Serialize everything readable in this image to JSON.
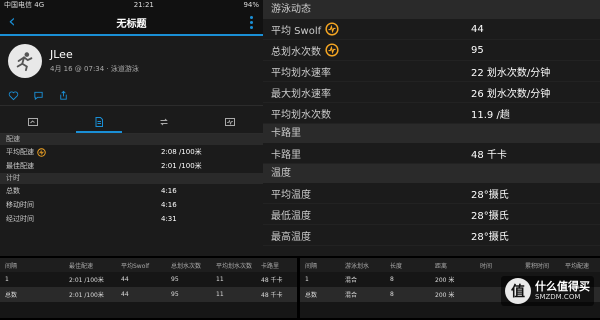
{
  "status": {
    "carrier": "中国电信",
    "network": "4G",
    "time": "21:21",
    "battery": "94%"
  },
  "nav": {
    "title": "无标题"
  },
  "profile": {
    "name": "JLee",
    "meta": "4月 16 @ 07:34 · 泳道游泳"
  },
  "left": {
    "pace_header": "配速",
    "avg_pace_label": "平均配速",
    "avg_pace_value": "2:08 /100米",
    "best_pace_label": "最佳配速",
    "best_pace_value": "2:01 /100米",
    "timing_header": "计时",
    "total_label": "总数",
    "total_value": "4:16",
    "moving_label": "移动时间",
    "moving_value": "4:16",
    "elapsed_label": "经过时间",
    "elapsed_value": "4:31"
  },
  "right": {
    "swim_header": "游泳动态",
    "swolf_label": "平均 Swolf",
    "swolf_value": "44",
    "strokes_label": "总划水次数",
    "strokes_value": "95",
    "avg_rate_label": "平均划水速率",
    "avg_rate_value": "22 划水次数/分钟",
    "max_rate_label": "最大划水速率",
    "max_rate_value": "26 划水次数/分钟",
    "avg_strokes_label": "平均划水次数",
    "avg_strokes_value": "11.9 /趟",
    "cal_header": "卡路里",
    "cal_label": "卡路里",
    "cal_value": "48 千卡",
    "temp_header": "温度",
    "avg_temp_label": "平均温度",
    "avg_temp_value": "28°摄氏",
    "min_temp_label": "最低温度",
    "min_temp_value": "28°摄氏",
    "max_temp_label": "最高温度",
    "max_temp_value": "28°摄氏"
  },
  "table1": {
    "headers": [
      "间隔",
      "最佳配速",
      "平均Swolf",
      "总划水次数",
      "平均划水次数",
      "卡路里"
    ],
    "rows": [
      [
        "1",
        "2:01 /100米",
        "44",
        "95",
        "11",
        "48 千卡"
      ],
      [
        "总数",
        "2:01 /100米",
        "44",
        "95",
        "11",
        "48 千卡"
      ]
    ]
  },
  "table2": {
    "headers": [
      "间隔",
      "游泳划水",
      "长度",
      "距离",
      "时间",
      "累积时间",
      "平均配速"
    ],
    "rows": [
      [
        "1",
        "混合",
        "8",
        "200 米",
        "",
        "",
        ""
      ],
      [
        "总数",
        "混合",
        "8",
        "200 米",
        "",
        "",
        ""
      ]
    ]
  },
  "watermark": {
    "logo": "值",
    "text": "什么值得买",
    "sub": "SMZDM.COM"
  },
  "colors": {
    "accent": "#1a8fd6",
    "icon_orange": "#f5a623",
    "background": "#1b1b1b"
  }
}
